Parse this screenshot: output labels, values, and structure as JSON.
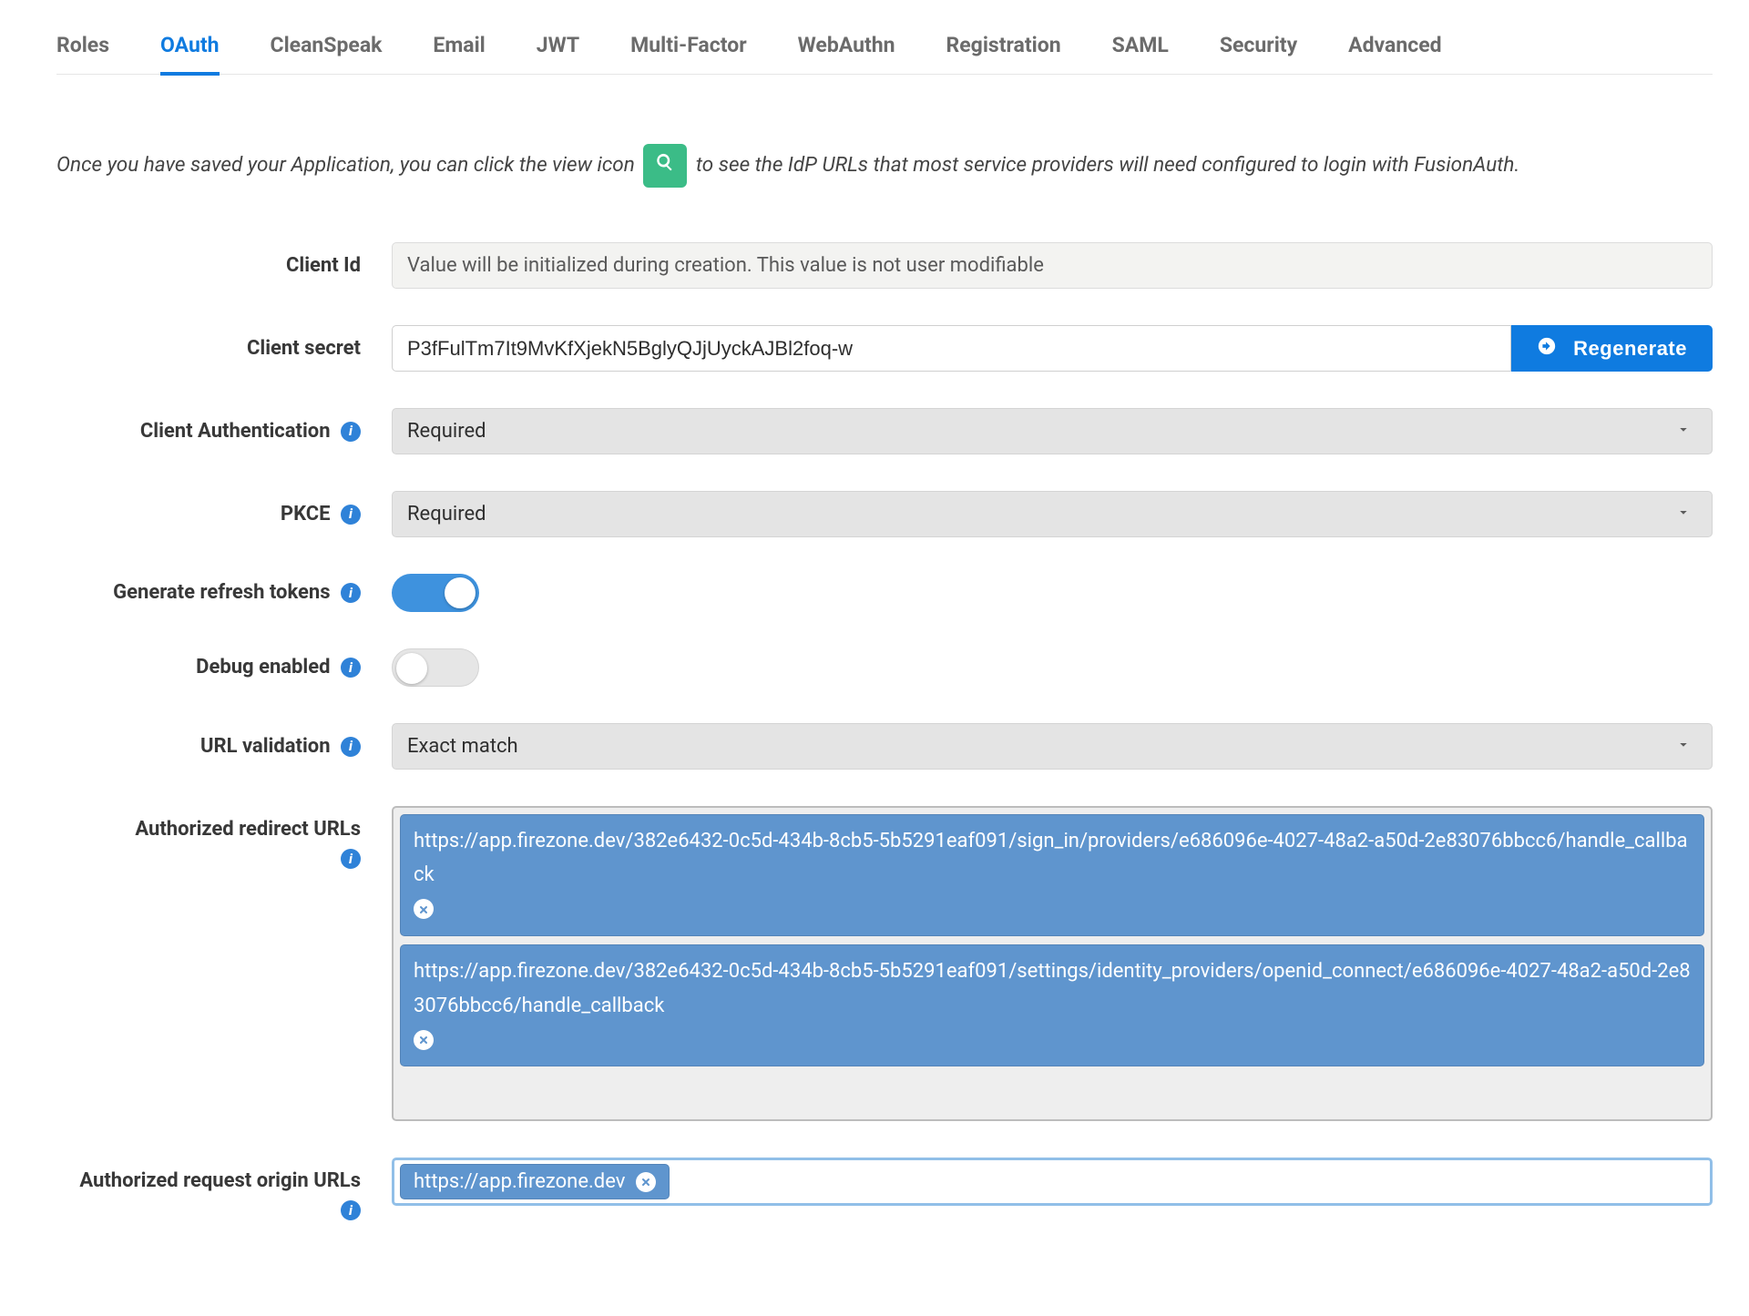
{
  "tabs": {
    "roles": "Roles",
    "oauth": "OAuth",
    "cleanspeak": "CleanSpeak",
    "email": "Email",
    "jwt": "JWT",
    "multifactor": "Multi-Factor",
    "webauthn": "WebAuthn",
    "registration": "Registration",
    "saml": "SAML",
    "security": "Security",
    "advanced": "Advanced",
    "active": "oauth"
  },
  "intro": {
    "prefix": "Once you have saved your Application, you can click the view icon",
    "suffix": "to see the IdP URLs that most service providers will need configured to login with FusionAuth."
  },
  "labels": {
    "client_id": "Client Id",
    "client_secret": "Client secret",
    "client_auth": "Client Authentication",
    "pkce": "PKCE",
    "generate_refresh": "Generate refresh tokens",
    "debug_enabled": "Debug enabled",
    "url_validation": "URL validation",
    "auth_redirect": "Authorized redirect URLs",
    "auth_origin": "Authorized request origin URLs"
  },
  "values": {
    "client_id_placeholder": "Value will be initialized during creation. This value is not user modifiable",
    "client_secret": "P3fFulTm7It9MvKfXjekN5BglyQJjUyckAJBl2foq-w",
    "regenerate": "Regenerate",
    "client_auth": "Required",
    "pkce": "Required",
    "url_validation": "Exact match"
  },
  "redirect_urls": [
    "https://app.firezone.dev/382e6432-0c5d-434b-8cb5-5b5291eaf091/sign_in/providers/e686096e-4027-48a2-a50d-2e83076bbcc6/handle_callback",
    "https://app.firezone.dev/382e6432-0c5d-434b-8cb5-5b5291eaf091/settings/identity_providers/openid_connect/e686096e-4027-48a2-a50d-2e83076bbcc6/handle_callback"
  ],
  "origin_urls": [
    "https://app.firezone.dev"
  ],
  "toggles": {
    "generate_refresh": true,
    "debug_enabled": false
  }
}
